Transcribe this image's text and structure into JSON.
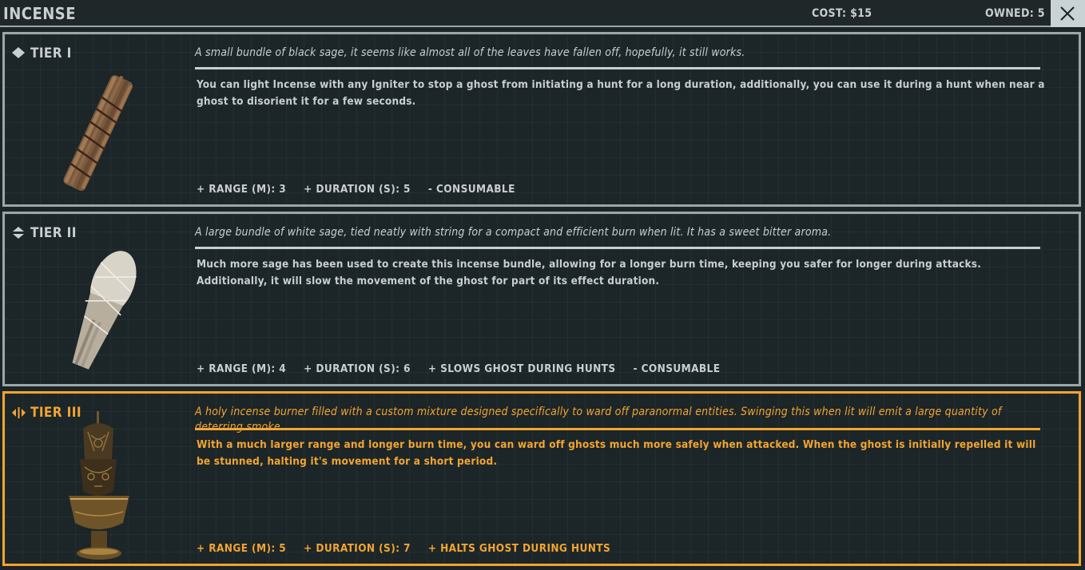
{
  "header": {
    "title": "INCENSE",
    "cost": "COST: $15",
    "owned": "OWNED: 5",
    "close_icon": "close-icon"
  },
  "colors": {
    "accent_selected": "#f2a531",
    "border_default": "#9ba6a9",
    "text": "#c9ced0",
    "background": "#1b2426"
  },
  "tiers": [
    {
      "label": "TIER I",
      "icon": "tier-1-diamond-icon",
      "flavor": "A small bundle of black sage, it seems like almost all of the leaves have fallen off, hopefully, it still works.",
      "description": "You can light Incense with any Igniter to stop a ghost from initiating a hunt for a long duration, additionally, you can use it during a hunt when near a ghost to disorient it for a few seconds.",
      "stats": [
        "+ RANGE (M): 3",
        "+ DURATION (S): 5",
        "- CONSUMABLE"
      ],
      "selected": false
    },
    {
      "label": "TIER II",
      "icon": "tier-2-chevrons-icon",
      "flavor": "A large bundle of white sage, tied neatly with string for a compact and efficient burn when lit. It has a sweet bitter aroma.",
      "description": "Much more sage has been used to create this incense bundle, allowing for a longer burn time, keeping you safer for longer during attacks. Additionally, it will slow the movement of the ghost for part of its effect duration.",
      "stats": [
        "+ RANGE (M): 4",
        "+ DURATION (S): 6",
        "+ SLOWS GHOST DURING HUNTS",
        "- CONSUMABLE"
      ],
      "selected": false
    },
    {
      "label": "TIER III",
      "icon": "tier-3-arrows-icon",
      "flavor": "A holy incense burner filled with a custom mixture designed specifically to ward off paranormal entities. Swinging this when lit will emit a large quantity of deterring smoke.",
      "description": "With a much larger range and longer burn time, you can ward off ghosts much more safely when attacked. When the ghost is initially repelled it will be stunned, halting it's movement for a short period.",
      "stats": [
        "+ RANGE (M): 5",
        "+ DURATION (S): 7",
        "+ HALTS GHOST DURING HUNTS"
      ],
      "selected": true
    }
  ]
}
